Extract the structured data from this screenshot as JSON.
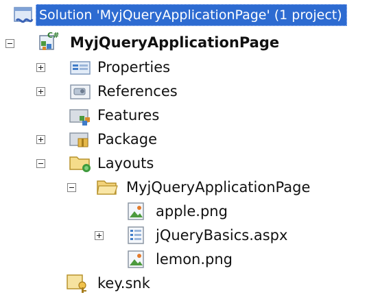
{
  "solution": {
    "label": "Solution 'MyjQueryApplicationPage' (1 project)",
    "icon": "solution-icon"
  },
  "project": {
    "label": "MyjQueryApplicationPage",
    "icon": "csharp-project-icon"
  },
  "nodes": [
    {
      "label": "Properties",
      "icon": "properties-icon"
    },
    {
      "label": "References",
      "icon": "references-icon"
    },
    {
      "label": "Features",
      "icon": "features-folder-icon"
    },
    {
      "label": "Package",
      "icon": "package-icon"
    },
    {
      "label": "Layouts",
      "icon": "layouts-folder-icon"
    }
  ],
  "layouts_folder": {
    "label": "MyjQueryApplicationPage",
    "icon": "open-folder-icon"
  },
  "files": [
    {
      "label": "apple.png",
      "icon": "image-file-icon"
    },
    {
      "label": "jQueryBasics.aspx",
      "icon": "aspx-file-icon"
    },
    {
      "label": "lemon.png",
      "icon": "image-file-icon"
    }
  ],
  "keyfile": {
    "label": "key.snk",
    "icon": "key-file-icon"
  },
  "colors": {
    "selection": "#2d6bd1",
    "text": "#111111"
  }
}
